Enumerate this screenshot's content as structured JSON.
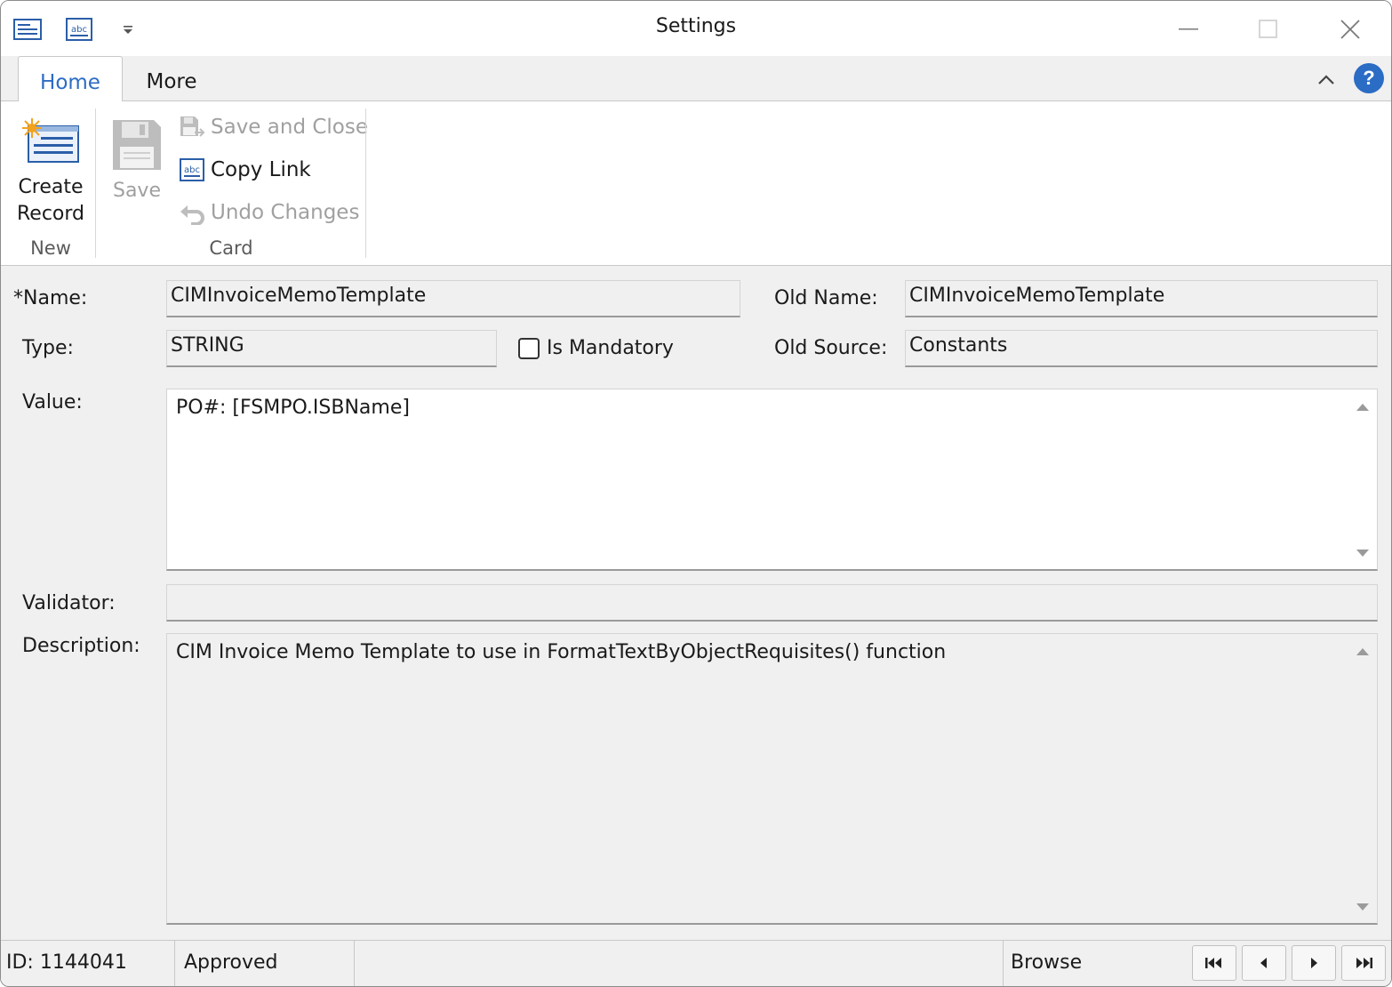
{
  "window": {
    "title": "Settings",
    "qat_icons": [
      "form-icon",
      "abc-icon",
      "customize-dropdown-icon"
    ]
  },
  "ribbon": {
    "tabs": [
      {
        "label": "Home",
        "active": true
      },
      {
        "label": "More",
        "active": false
      }
    ],
    "groups": {
      "new": {
        "label": "New",
        "create_record_line1": "Create",
        "create_record_line2": "Record"
      },
      "card": {
        "label": "Card",
        "save": "Save",
        "save_and_close": "Save and Close",
        "copy_link": "Copy Link",
        "undo_changes": "Undo Changes"
      }
    },
    "help_label": "?"
  },
  "form": {
    "name_label": "*Name:",
    "name_value": "CIMInvoiceMemoTemplate",
    "old_name_label": "Old Name:",
    "old_name_value": "CIMInvoiceMemoTemplate",
    "type_label": "Type:",
    "type_value": "STRING",
    "is_mandatory_label": "Is Mandatory",
    "is_mandatory_checked": false,
    "old_source_label": "Old Source:",
    "old_source_value": "Constants",
    "value_label": "Value:",
    "value_text": "PO#: [FSMPO.ISBName]",
    "validator_label": "Validator:",
    "validator_value": "",
    "description_label": "Description:",
    "description_text": "CIM Invoice Memo Template to use in FormatTextByObjectRequisites() function"
  },
  "status": {
    "id": "ID: 1144041",
    "state": "Approved",
    "mode": "Browse"
  },
  "colors": {
    "accent": "#2b6cc4",
    "disabled_text": "#a0a0a0",
    "panel_bg": "#f0f0f0"
  }
}
